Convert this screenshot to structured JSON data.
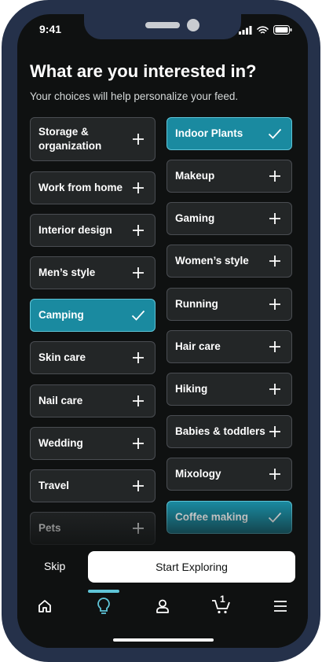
{
  "status_bar": {
    "time": "9:41"
  },
  "header": {
    "title": "What are you interested in?",
    "subtitle": "Your choices will help personalize your feed."
  },
  "interests": {
    "left": [
      {
        "label": "Storage & organization",
        "selected": false
      },
      {
        "label": "Work from home",
        "selected": false
      },
      {
        "label": "Interior design",
        "selected": false
      },
      {
        "label": "Men’s style",
        "selected": false
      },
      {
        "label": "Camping",
        "selected": true
      },
      {
        "label": "Skin care",
        "selected": false
      },
      {
        "label": "Nail care",
        "selected": false
      },
      {
        "label": "Wedding",
        "selected": false
      },
      {
        "label": "Travel",
        "selected": false
      },
      {
        "label": "Pets",
        "selected": false
      }
    ],
    "right": [
      {
        "label": "Indoor Plants",
        "selected": true
      },
      {
        "label": "Makeup",
        "selected": false
      },
      {
        "label": "Gaming",
        "selected": false
      },
      {
        "label": "Women’s style",
        "selected": false
      },
      {
        "label": "Running",
        "selected": false
      },
      {
        "label": "Hair care",
        "selected": false
      },
      {
        "label": "Hiking",
        "selected": false
      },
      {
        "label": "Babies & toddlers",
        "selected": false
      },
      {
        "label": "Mixology",
        "selected": false
      },
      {
        "label": "Coffee making",
        "selected": true
      }
    ]
  },
  "footer": {
    "skip_label": "Skip",
    "start_label": "Start Exploring"
  },
  "nav": {
    "items": [
      {
        "icon": "home-icon"
      },
      {
        "icon": "lightbulb-icon",
        "active": true
      },
      {
        "icon": "person-icon"
      },
      {
        "icon": "cart-icon",
        "badge": "1"
      },
      {
        "icon": "menu-icon"
      }
    ]
  },
  "colors": {
    "background": "#0f1111",
    "chip": "#232627",
    "chip_selected": "#1a8aa0",
    "accent": "#5fc5d8",
    "frame": "#25314a"
  }
}
